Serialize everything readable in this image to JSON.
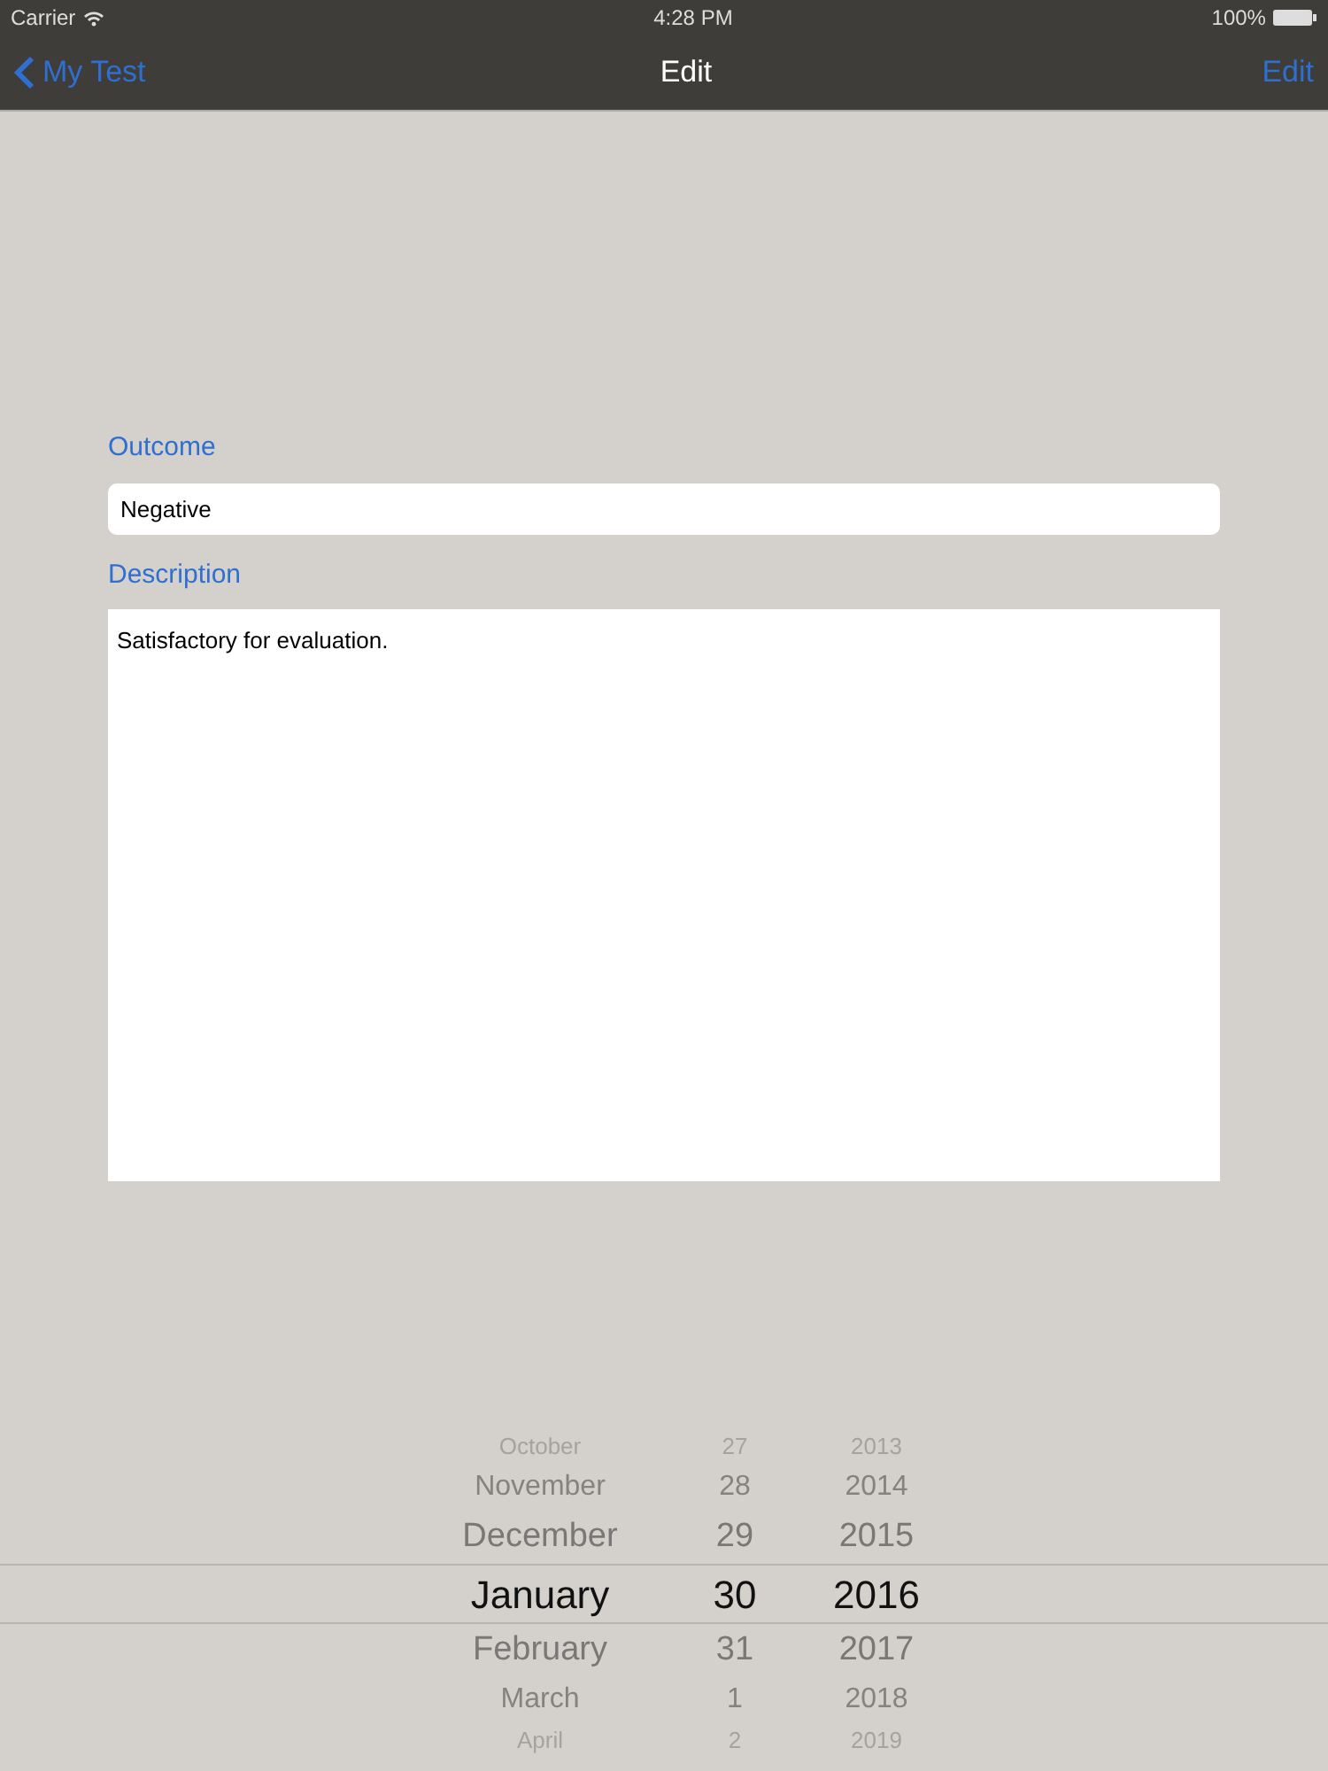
{
  "status_bar": {
    "carrier": "Carrier",
    "time": "4:28 PM",
    "battery": "100%"
  },
  "nav": {
    "back": "My Test",
    "title": "Edit",
    "action": "Edit"
  },
  "form": {
    "outcome_label": "Outcome",
    "outcome_value": "Negative",
    "description_label": "Description",
    "description_value": "Satisfactory for evaluation."
  },
  "picker": {
    "rows": [
      {
        "month": "October",
        "day": "27",
        "year": "2013",
        "selected": false
      },
      {
        "month": "November",
        "day": "28",
        "year": "2014",
        "selected": false
      },
      {
        "month": "December",
        "day": "29",
        "year": "2015",
        "selected": false
      },
      {
        "month": "January",
        "day": "30",
        "year": "2016",
        "selected": true
      },
      {
        "month": "February",
        "day": "31",
        "year": "2017",
        "selected": false
      },
      {
        "month": "March",
        "day": "1",
        "year": "2018",
        "selected": false
      },
      {
        "month": "April",
        "day": "2",
        "year": "2019",
        "selected": false
      }
    ]
  }
}
